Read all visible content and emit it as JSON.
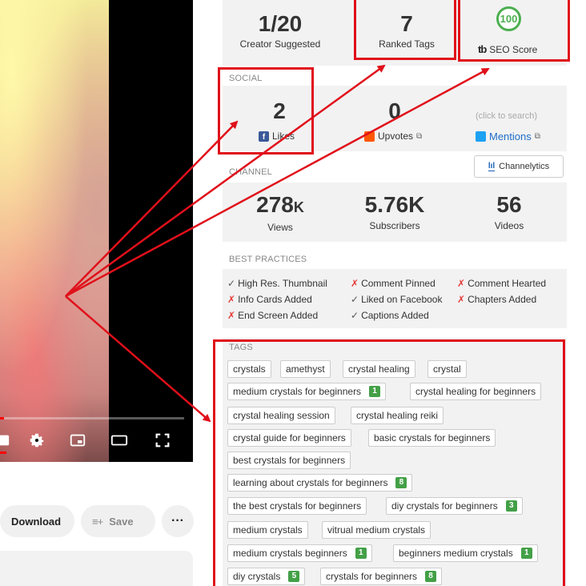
{
  "video": {
    "progress_fraction": 0.02,
    "controls": [
      "subtitles-icon",
      "gear-icon",
      "miniplayer-icon",
      "theater-icon",
      "fullscreen-icon"
    ]
  },
  "actions": {
    "download_label": "Download",
    "save_icon": "≡+",
    "save_label": "Save",
    "more_label": "···"
  },
  "stats": {
    "creator_suggested_value": "1/20",
    "creator_suggested_label": "Creator Suggested",
    "ranked_tags_value": "7",
    "ranked_tags_label": "Ranked Tags",
    "seo_score_value": "100",
    "seo_score_logo": "tb",
    "seo_score_label": "SEO Score"
  },
  "social": {
    "title": "SOCIAL",
    "likes_value": "2",
    "likes_label": "Likes",
    "upvotes_value": "0",
    "upvotes_label": "Upvotes",
    "search_hint": "(click to search)",
    "mentions_label": "Mentions"
  },
  "channel": {
    "title": "CHANNEL",
    "channelytics_label": "Channelytics",
    "views_value": "278",
    "views_suffix": "K",
    "views_label": "Views",
    "subscribers_value": "5.76K",
    "subscribers_label": "Subscribers",
    "videos_value": "56",
    "videos_label": "Videos"
  },
  "best_practices": {
    "title": "BEST PRACTICES",
    "items": [
      {
        "mark": "✓",
        "label": "High Res. Thumbnail",
        "ok": true
      },
      {
        "mark": "✗",
        "label": "Comment Pinned",
        "ok": false
      },
      {
        "mark": "✗",
        "label": "Comment Hearted",
        "ok": false
      },
      {
        "mark": "✗",
        "label": "Info Cards Added",
        "ok": false
      },
      {
        "mark": "✓",
        "label": "Liked on Facebook",
        "ok": true
      },
      {
        "mark": "✗",
        "label": "Chapters Added",
        "ok": false
      },
      {
        "mark": "✗",
        "label": "End Screen Added",
        "ok": false
      },
      {
        "mark": "✓",
        "label": "Captions Added",
        "ok": true
      }
    ]
  },
  "tags": {
    "title": "TAGS",
    "items": [
      {
        "label": "crystals",
        "rank": ""
      },
      {
        "label": "amethyst",
        "rank": ""
      },
      {
        "label": "crystal healing",
        "rank": ""
      },
      {
        "label": "crystal",
        "rank": ""
      },
      {
        "label": "medium crystals for beginners",
        "rank": "1"
      },
      {
        "label": "crystal healing for beginners",
        "rank": ""
      },
      {
        "label": "crystal healing session",
        "rank": ""
      },
      {
        "label": "crystal healing reiki",
        "rank": ""
      },
      {
        "label": "crystal guide for beginners",
        "rank": ""
      },
      {
        "label": "basic crystals for beginners",
        "rank": ""
      },
      {
        "label": "best crystals for beginners",
        "rank": ""
      },
      {
        "label": "learning about crystals for beginners",
        "rank": "8"
      },
      {
        "label": "the best crystals for beginners",
        "rank": ""
      },
      {
        "label": "diy crystals for beginners",
        "rank": "3"
      },
      {
        "label": "medium crystals",
        "rank": ""
      },
      {
        "label": "vitrual medium crystals",
        "rank": ""
      },
      {
        "label": "medium crystals beginners",
        "rank": "1"
      },
      {
        "label": "beginners medium crystals",
        "rank": "1"
      },
      {
        "label": "diy crystals",
        "rank": "5"
      },
      {
        "label": "crystals for beginners",
        "rank": "8"
      }
    ]
  },
  "colors": {
    "highlight": "#e0101a",
    "rank_badge": "#43a047",
    "score_ring": "#4caf50",
    "progress": "#ff0000"
  }
}
